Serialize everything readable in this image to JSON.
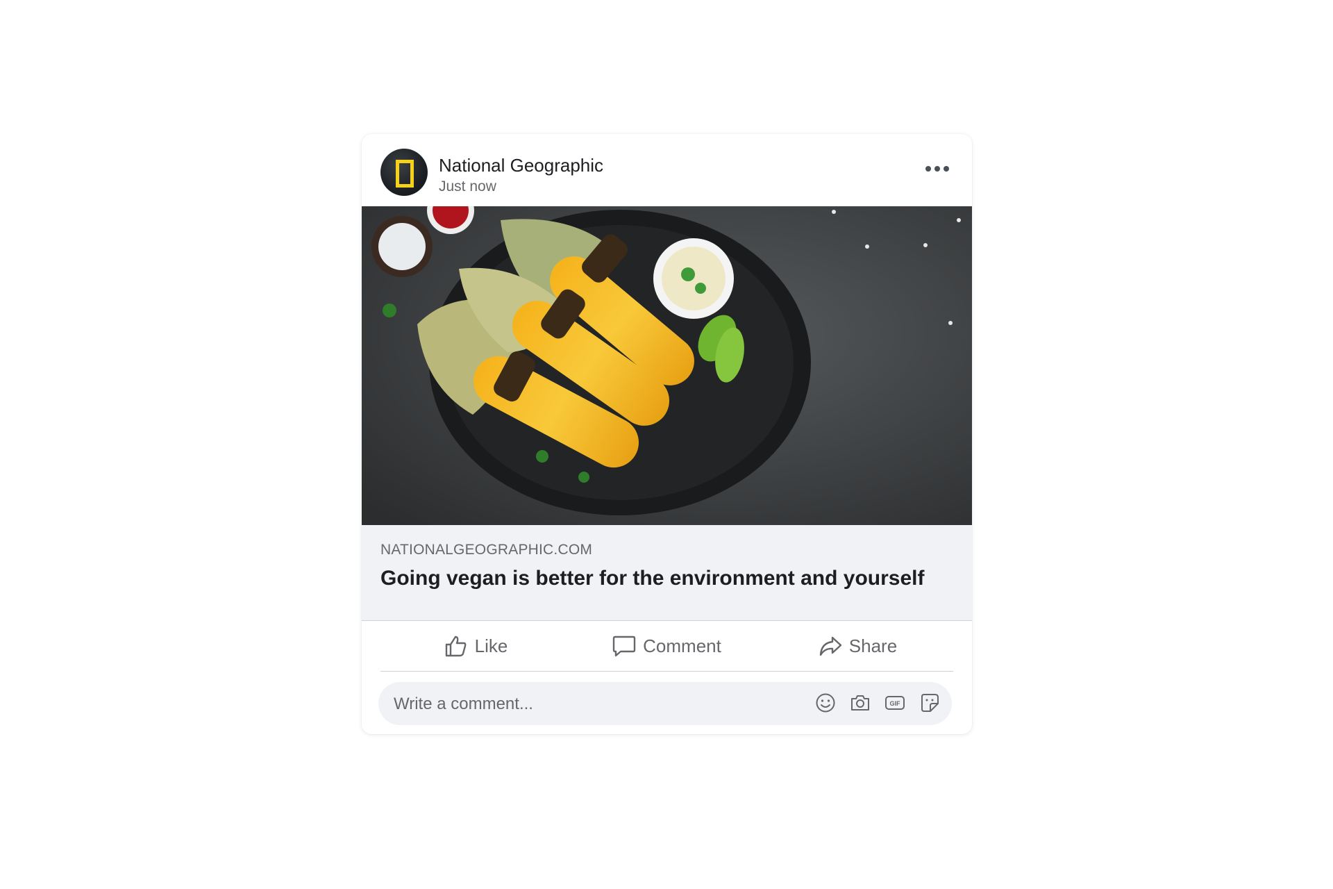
{
  "post": {
    "page_name": "National Geographic",
    "timestamp": "Just now",
    "avatar_icon": "national-geographic-logo",
    "more_icon": "more-options-icon",
    "image_alt": "grilled-corn-on-plate"
  },
  "link": {
    "domain": "NATIONALGEOGRAPHIC.COM",
    "title": "Going vegan is better for the environment and yourself"
  },
  "actions": {
    "like_label": "Like",
    "comment_label": "Comment",
    "share_label": "Share"
  },
  "comment": {
    "placeholder": "Write a comment...",
    "icons": [
      "emoji-icon",
      "camera-icon",
      "gif-icon",
      "sticker-icon"
    ]
  },
  "colors": {
    "text_primary": "#1c1e21",
    "text_secondary": "#65676b",
    "link_bg": "#f0f2f5",
    "ng_yellow": "#f7d117"
  }
}
